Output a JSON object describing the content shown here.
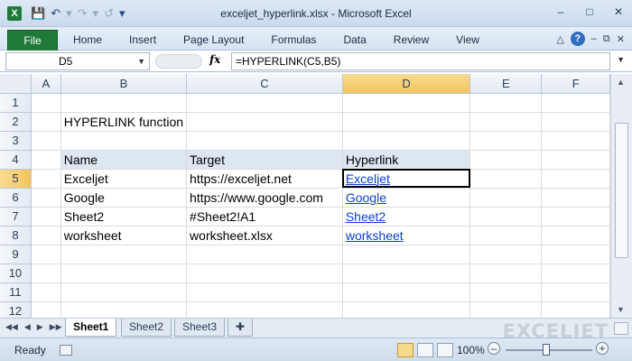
{
  "window": {
    "title": "exceljet_hyperlink.xlsx - Microsoft Excel",
    "app_icon_letter": "X",
    "controls": [
      "–",
      "□",
      "✕"
    ]
  },
  "ribbon": {
    "file_tab": "File",
    "tabs": [
      "Home",
      "Insert",
      "Page Layout",
      "Formulas",
      "Data",
      "Review",
      "View"
    ]
  },
  "formula_bar": {
    "name_box": "D5",
    "fx_label": "fx",
    "formula": "=HYPERLINK(C5,B5)"
  },
  "sheet": {
    "columns": [
      "A",
      "B",
      "C",
      "D",
      "E",
      "F"
    ],
    "rows": [
      "1",
      "2",
      "3",
      "4",
      "5",
      "6",
      "7",
      "8",
      "9",
      "10",
      "11",
      "12"
    ],
    "title": "HYPERLINK function",
    "header": [
      "Name",
      "Target",
      "Hyperlink"
    ],
    "data": [
      [
        "Exceljet",
        "https://exceljet.net",
        "Exceljet"
      ],
      [
        "Google",
        "https://www.google.com",
        "Google"
      ],
      [
        "Sheet2",
        "#Sheet2!A1",
        "Sheet2"
      ],
      [
        "worksheet",
        "worksheet.xlsx",
        "worksheet"
      ]
    ],
    "active_cell": "D5"
  },
  "sheet_tabs": {
    "tabs": [
      "Sheet1",
      "Sheet2",
      "Sheet3"
    ],
    "active": "Sheet1",
    "logo": "EXCELJET"
  },
  "status_bar": {
    "status": "Ready",
    "zoom": "100%"
  },
  "colors": {
    "accent": "#1f7a3a",
    "link": "#0b3fd1",
    "header_fill": "#dde7f2",
    "active_header": "#f2c55c"
  }
}
